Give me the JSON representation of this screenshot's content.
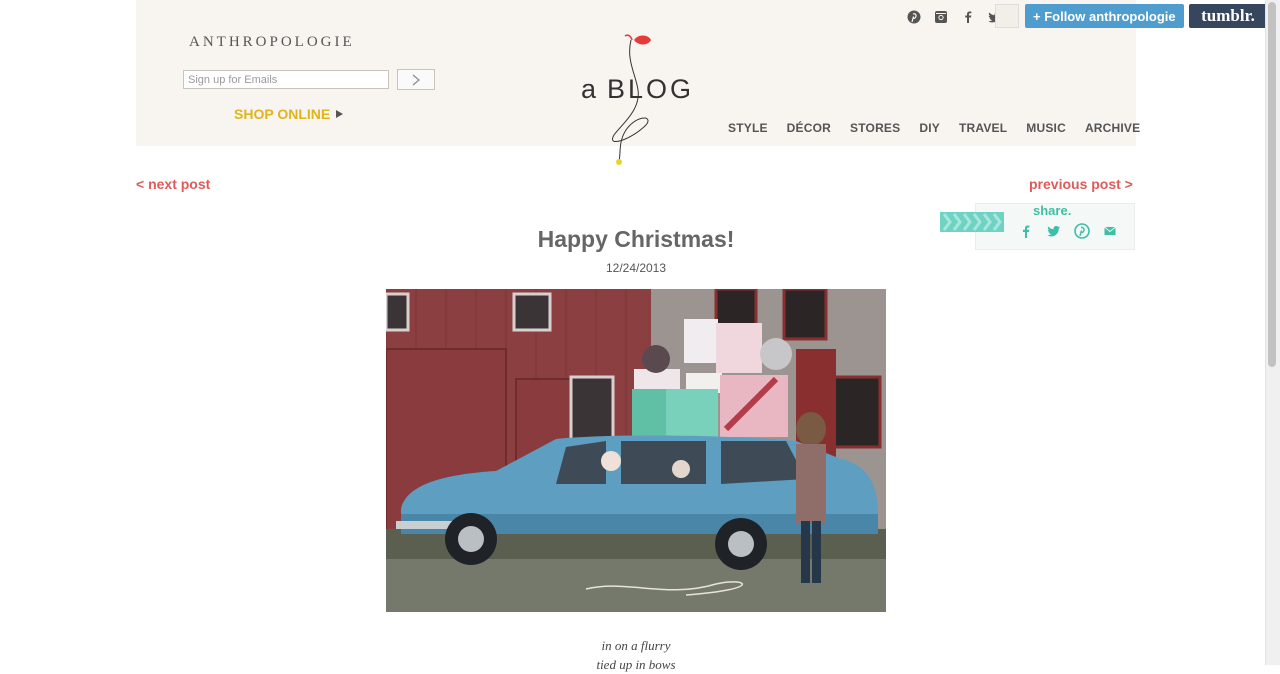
{
  "header": {
    "brand": "ANTHROPOLOGIE",
    "email_placeholder": "Sign up for Emails",
    "shop_online": "SHOP ONLINE",
    "logo_prefix": "a",
    "logo_word": "BLOG",
    "nav": [
      "STYLE",
      "DÉCOR",
      "STORES",
      "DIY",
      "TRAVEL",
      "MUSIC",
      "ARCHIVE"
    ]
  },
  "topbar": {
    "social_icons": [
      "pinterest-icon",
      "instagram-icon",
      "facebook-icon",
      "twitter-icon"
    ],
    "follow_label": "+ Follow anthropologie",
    "tumblr_label": "tumblr."
  },
  "post_nav": {
    "next": "< next post",
    "previous": "previous post >"
  },
  "share": {
    "label": "share.",
    "icons": [
      "facebook-icon",
      "twitter-icon",
      "pinterest-icon",
      "email-icon"
    ]
  },
  "post": {
    "title": "Happy Christmas!",
    "date": "12/24/2013",
    "poem_lines": [
      "in on a flurry",
      "tied up in bows"
    ]
  },
  "colors": {
    "accent_red": "#e05a5a",
    "shop_yellow": "#e0b41a",
    "share_teal": "#3dbfa7",
    "tumblr_navy": "#36465d",
    "follow_blue": "#4f9ccf",
    "header_bg": "#f8f5f0"
  }
}
